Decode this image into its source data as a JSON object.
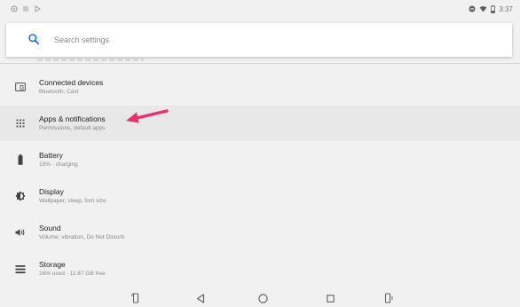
{
  "status_bar": {
    "time": "3:37",
    "left_icons": [
      "settings-icon",
      "notification-icon",
      "play-store-icon"
    ],
    "right_icons": [
      "do-not-disturb-icon",
      "wifi-icon",
      "battery-icon"
    ]
  },
  "search": {
    "placeholder": "Search settings"
  },
  "items": [
    {
      "id": "connected-devices",
      "title": "Connected devices",
      "subtitle": "Bluetooth, Cast",
      "icon": "devices-icon"
    },
    {
      "id": "apps-notifications",
      "title": "Apps & notifications",
      "subtitle": "Permissions, default apps",
      "icon": "apps-grid-icon"
    },
    {
      "id": "battery",
      "title": "Battery",
      "subtitle": "19% - charging",
      "icon": "battery-icon"
    },
    {
      "id": "display",
      "title": "Display",
      "subtitle": "Wallpaper, sleep, font size",
      "icon": "brightness-icon"
    },
    {
      "id": "sound",
      "title": "Sound",
      "subtitle": "Volume, vibration, Do Not Disturb",
      "icon": "volume-icon"
    },
    {
      "id": "storage",
      "title": "Storage",
      "subtitle": "26% used - 11.87 GB free",
      "icon": "storage-icon"
    }
  ],
  "colors": {
    "accent": "#1a73e8",
    "annotation_arrow": "#e8306e",
    "background": "#f1f1f1",
    "highlight": "#e8e8e8"
  },
  "nav_bar": {
    "buttons": [
      "rotate-icon",
      "back-icon",
      "home-icon",
      "recents-icon",
      "volume-down-icon"
    ]
  }
}
